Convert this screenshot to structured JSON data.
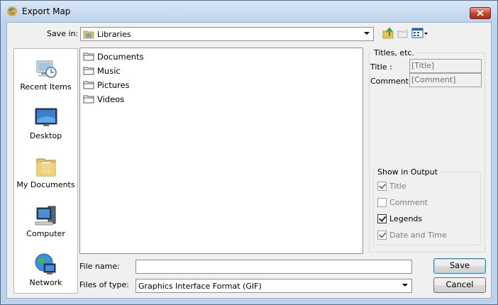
{
  "window": {
    "title": "Export Map"
  },
  "toolbar": {
    "save_in_label": "Save in:",
    "save_in_value": "Libraries",
    "icons": [
      "up-folder-icon",
      "new-folder-icon",
      "view-menu-icon"
    ]
  },
  "places": [
    {
      "label": "Recent Items",
      "icon": "recent-items-icon"
    },
    {
      "label": "Desktop",
      "icon": "desktop-icon"
    },
    {
      "label": "My Documents",
      "icon": "documents-icon"
    },
    {
      "label": "Computer",
      "icon": "computer-icon"
    },
    {
      "label": "Network",
      "icon": "network-icon"
    }
  ],
  "files": [
    {
      "name": "Documents"
    },
    {
      "name": "Music"
    },
    {
      "name": "Pictures"
    },
    {
      "name": "Videos"
    }
  ],
  "titles": {
    "heading": "Titles, etc.",
    "title_label": "Title :",
    "title_value": "[Title]",
    "comment_label": "Comment :",
    "comment_value": "[Comment]"
  },
  "show_output": {
    "heading": "Show in Output",
    "options": [
      {
        "label": "Title",
        "checked": true,
        "enabled": false
      },
      {
        "label": "Comment",
        "checked": false,
        "enabled": false
      },
      {
        "label": "Legends",
        "checked": true,
        "enabled": true
      },
      {
        "label": "Date and Time",
        "checked": true,
        "enabled": false
      }
    ]
  },
  "bottom": {
    "file_name_label": "File name:",
    "file_name_value": "",
    "file_type_label": "Files of type:",
    "file_type_value": "Graphics Interface Format (GIF)",
    "save_label": "Save",
    "cancel_label": "Cancel"
  },
  "colors": {
    "titlebar": "#bcd3ec",
    "close": "#c7422e",
    "folder": "#e8c35b"
  }
}
